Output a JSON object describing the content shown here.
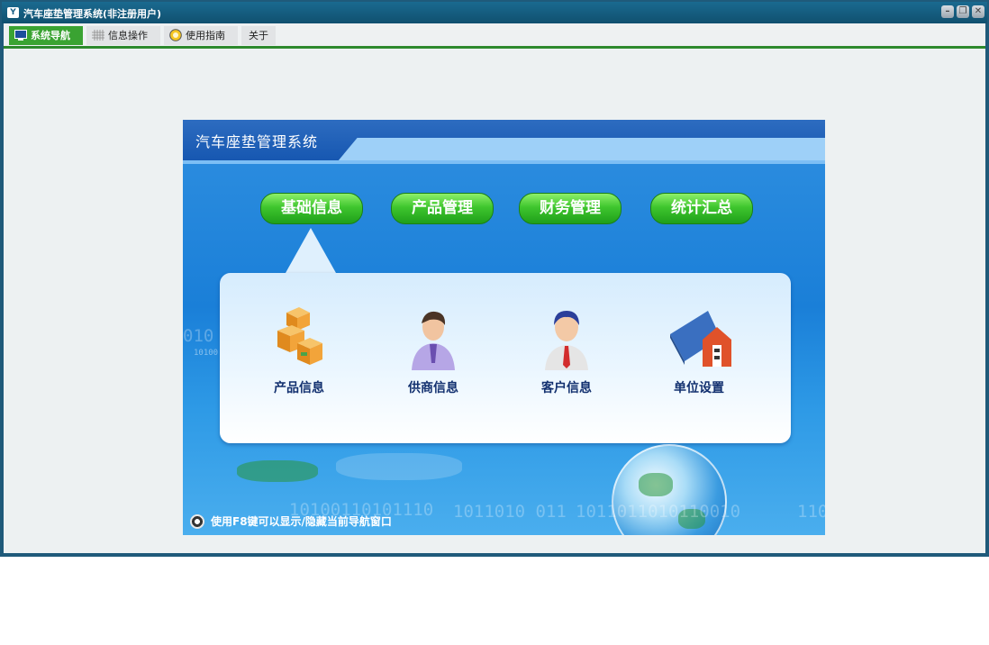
{
  "window": {
    "title": "汽车座垫管理系统(非注册用户)",
    "app_icon_text": "Y",
    "controls": {
      "minimize": "–",
      "restore": "❐",
      "close": "✕"
    }
  },
  "tabs": [
    {
      "label": "系统导航",
      "icon": "monitor-icon",
      "active": true
    },
    {
      "label": "信息操作",
      "icon": "grid-icon",
      "active": false
    },
    {
      "label": "使用指南",
      "icon": "help-icon",
      "active": false
    },
    {
      "label": "关于",
      "icon": "",
      "active": false
    }
  ],
  "nav": {
    "title": "汽车座垫管理系统",
    "buttons": [
      "基础信息",
      "产品管理",
      "财务管理",
      "统计汇总"
    ],
    "selected": "基础信息",
    "items": [
      {
        "label": "产品信息",
        "icon": "boxes-icon"
      },
      {
        "label": "供商信息",
        "icon": "supplier-person-icon"
      },
      {
        "label": "客户信息",
        "icon": "customer-person-icon"
      },
      {
        "label": "单位设置",
        "icon": "building-icon"
      }
    ],
    "hint": "使用F8键可以显示/隐藏当前导航窗口",
    "background_text": [
      "010",
      "10100",
      "10100110101110",
      "1011010 011",
      "1011011010110010",
      "110"
    ]
  },
  "colors": {
    "titlebar": "#10506f",
    "active_tab": "#3aa332",
    "tab_underline": "#2d8a2d",
    "nav_header": "#1556b0",
    "nav_background": "#1a7fd8",
    "item_label": "#12306f"
  }
}
